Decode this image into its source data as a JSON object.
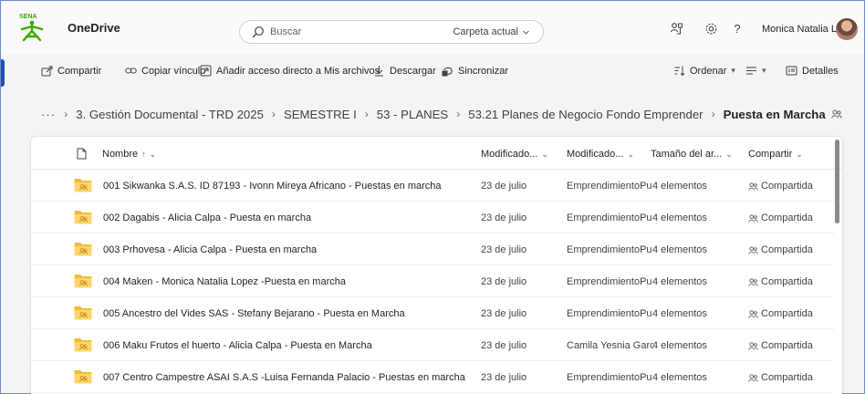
{
  "header": {
    "logo_text": "SENA",
    "app_name": "OneDrive",
    "search_placeholder": "Buscar",
    "search_scope": "Carpeta actual",
    "user_name": "Monica Natalia Lo...",
    "help": "?"
  },
  "command_bar": {
    "share": "Compartir",
    "copy_link": "Copiar vínculo",
    "add_shortcut": "Añadir acceso directo a Mis archivos",
    "download": "Descargar",
    "sync": "Sincronizar",
    "sort": "Ordenar",
    "details": "Detalles"
  },
  "breadcrumb": {
    "overflow": "···",
    "items": [
      "3. Gestión Documental - TRD 2025",
      "SEMESTRE I",
      "53 - PLANES",
      "53.21 Planes de Negocio Fondo Emprender"
    ],
    "current": "Puesta en Marcha"
  },
  "columns": {
    "name": "Nombre",
    "name_sort": "↑",
    "modified": "Modificado...",
    "modified_by": "Modificado...",
    "size": "Tamaño del ar...",
    "sharing": "Compartir"
  },
  "rows": [
    {
      "name": "001 Sikwanka S.A.S. ID 87193 - Ivonn Mireya Africano - Puestas en marcha",
      "modified": "23 de julio",
      "modified_by": "EmprendimientoPu",
      "size": "4 elementos",
      "sharing": "Compartida"
    },
    {
      "name": "002 Dagabis - Alicia Calpa - Puesta en marcha",
      "modified": "23 de julio",
      "modified_by": "EmprendimientoPu",
      "size": "4 elementos",
      "sharing": "Compartida"
    },
    {
      "name": "003 Prhovesa - Alicia Calpa - Puesta en marcha",
      "modified": "23 de julio",
      "modified_by": "EmprendimientoPu",
      "size": "4 elementos",
      "sharing": "Compartida"
    },
    {
      "name": "004 Maken - Monica Natalia Lopez -Puesta en marcha",
      "modified": "23 de julio",
      "modified_by": "EmprendimientoPu",
      "size": "4 elementos",
      "sharing": "Compartida"
    },
    {
      "name": "005 Ancestro del Vides SAS - Stefany Bejarano - Puesta en Marcha",
      "modified": "23 de julio",
      "modified_by": "EmprendimientoPu",
      "size": "4 elementos",
      "sharing": "Compartida"
    },
    {
      "name": "006 Maku Frutos el huerto - Alicia Calpa - Puesta en Marcha",
      "modified": "23 de julio",
      "modified_by": "Camila Yesnia Garci",
      "size": "4 elementos",
      "sharing": "Compartida"
    },
    {
      "name": "007 Centro Campestre ASAI S.A.S -Luisa Fernanda Palacio - Puestas en marcha",
      "modified": "23 de julio",
      "modified_by": "EmprendimientoPu",
      "size": "4 elementos",
      "sharing": "Compartida"
    }
  ],
  "colors": {
    "sena_green": "#39a900",
    "folder_yellow": "#f5bb37",
    "accent_blue": "#1f4fb5"
  }
}
